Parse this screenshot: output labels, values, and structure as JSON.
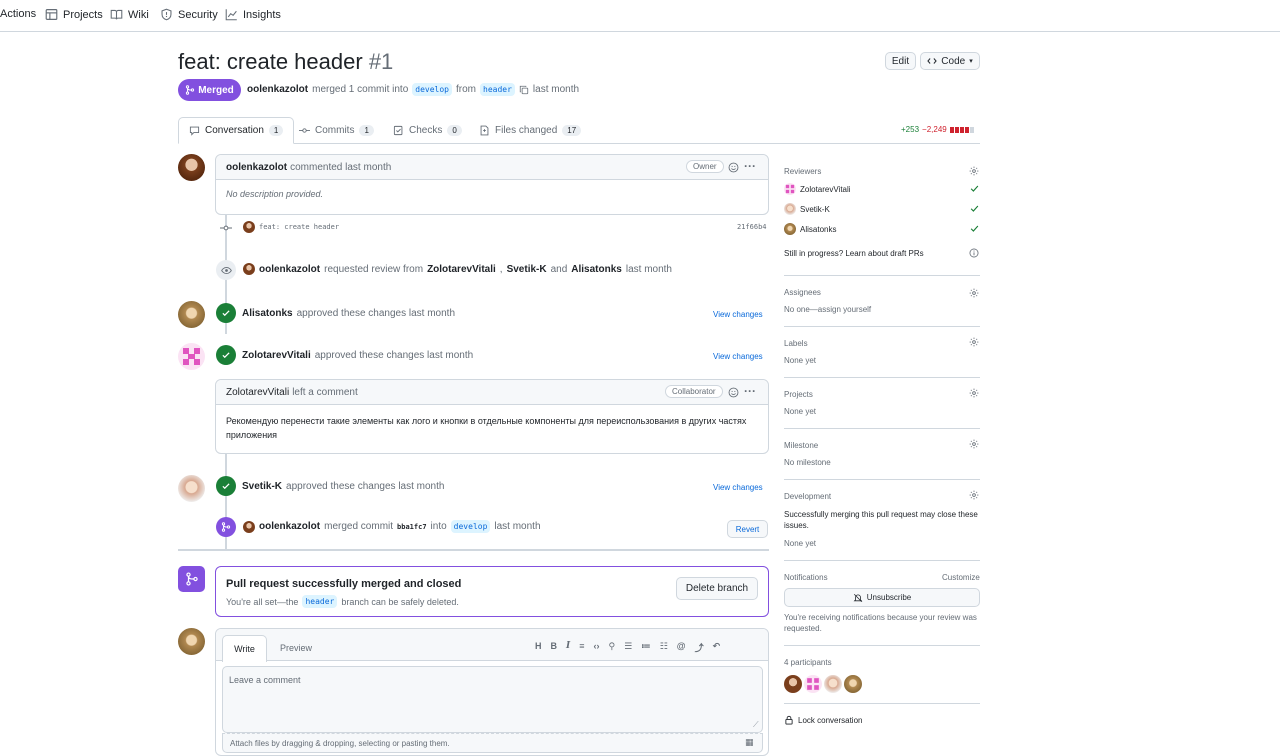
{
  "nav": {
    "actions": "Actions",
    "projects": "Projects",
    "wiki": "Wiki",
    "security": "Security",
    "insights": "Insights"
  },
  "pr": {
    "title": "feat: create header",
    "number": "#1",
    "edit": "Edit",
    "code": "Code",
    "status": "Merged",
    "author": "oolenkazolot",
    "merged_text": "merged 1 commit into",
    "base": "develop",
    "from": "from",
    "head": "header",
    "when": "last month"
  },
  "tabs": [
    {
      "label": "Conversation",
      "count": "1"
    },
    {
      "label": "Commits",
      "count": "1"
    },
    {
      "label": "Checks",
      "count": "0"
    },
    {
      "label": "Files changed",
      "count": "17"
    }
  ],
  "diffstat": {
    "add": "+253",
    "del": "−2,249"
  },
  "timeline": {
    "c1": {
      "author": "oolenkazolot",
      "action": "commented last month",
      "role": "Owner",
      "body": "No description provided."
    },
    "commit": {
      "msg": "feat: create header",
      "sha": "21f66b4"
    },
    "review_req": {
      "author": "oolenkazolot",
      "t1": "requested review from",
      "r1": "ZolotarevVitali",
      "r2": "Svetik-K",
      "and": "and",
      "r3": "Alisatonks",
      "when": "last month"
    },
    "a1": {
      "author": "Alisatonks",
      "text": "approved these changes last month",
      "link": "View changes"
    },
    "a2": {
      "author": "ZolotarevVitali",
      "text": "approved these changes last month",
      "link": "View changes"
    },
    "c2": {
      "author": "ZolotarevVitali",
      "action": "left a comment",
      "role": "Collaborator",
      "body": "Рекомендую перенести такие элементы как лого и кнопки в отдельные компоненты для переиспользования в других частях приложения"
    },
    "a3": {
      "author": "Svetik-K",
      "text": "approved these changes last month",
      "link": "View changes"
    },
    "merge": {
      "author": "oolenkazolot",
      "t1": "merged commit",
      "sha": "bba1fc7",
      "into": "into",
      "base": "develop",
      "when": "last month",
      "revert": "Revert"
    }
  },
  "merged_box": {
    "title": "Pull request successfully merged and closed",
    "text1": "You're all set—the",
    "branch": "header",
    "text2": "branch can be safely deleted.",
    "button": "Delete branch"
  },
  "editor": {
    "write": "Write",
    "preview": "Preview",
    "placeholder": "Leave a comment",
    "attach": "Attach files by dragging & dropping, selecting or pasting them."
  },
  "sidebar": {
    "reviewers": "Reviewers",
    "reviewer_list": [
      "ZolotarevVitali",
      "Svetik-K",
      "Alisatonks"
    ],
    "draft": "Still in progress? Learn about draft PRs",
    "assignees": "Assignees",
    "assignees_value": "No one—assign yourself",
    "labels": "Labels",
    "labels_value": "None yet",
    "projects": "Projects",
    "projects_value": "None yet",
    "milestone": "Milestone",
    "milestone_value": "No milestone",
    "development": "Development",
    "development_text": "Successfully merging this pull request may close these issues.",
    "development_value": "None yet",
    "notifications": "Notifications",
    "customize": "Customize",
    "unsubscribe": "Unsubscribe",
    "notif_text": "You're receiving notifications because your review was requested.",
    "participants": "4 participants",
    "lock": "Lock conversation"
  },
  "colors": {
    "merged": "#8250df",
    "approve": "#1a7f37",
    "link": "#0969da",
    "danger": "#cf222e"
  }
}
